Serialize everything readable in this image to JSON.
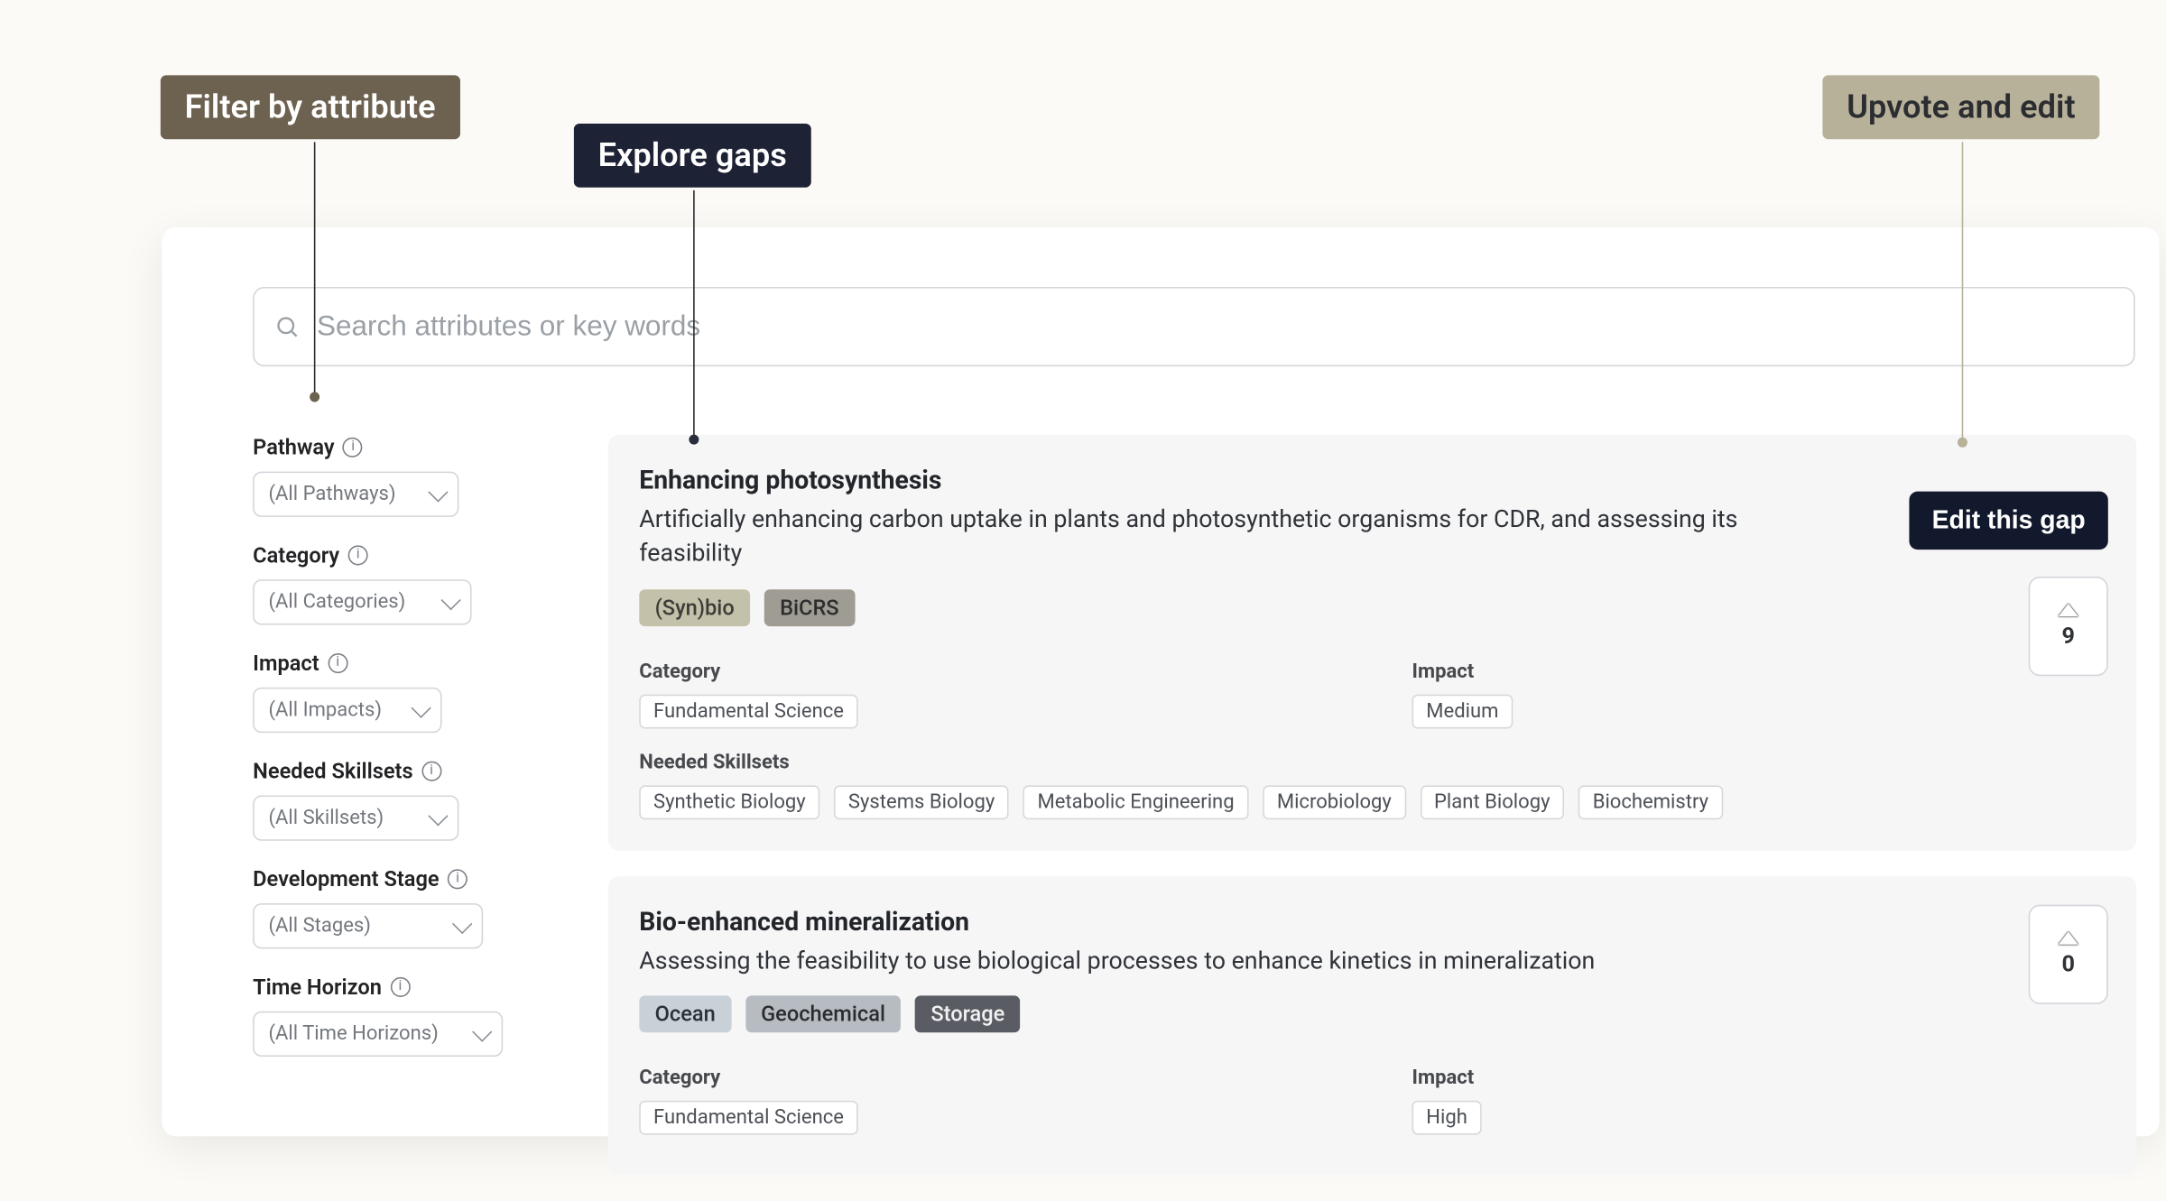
{
  "annotations": {
    "filter": "Filter by attribute",
    "explore": "Explore gaps",
    "upvote_edit": "Upvote and edit"
  },
  "search": {
    "placeholder": "Search attributes or key words"
  },
  "filters": {
    "pathway": {
      "label": "Pathway",
      "value": "(All Pathways)"
    },
    "category": {
      "label": "Category",
      "value": "(All Categories)"
    },
    "impact": {
      "label": "Impact",
      "value": "(All Impacts)"
    },
    "skillsets": {
      "label": "Needed Skillsets",
      "value": "(All Skillsets)"
    },
    "stage": {
      "label": "Development Stage",
      "value": "(All Stages)"
    },
    "horizon": {
      "label": "Time Horizon",
      "value": "(All Time Horizons)"
    }
  },
  "sections": {
    "category": "Category",
    "impact": "Impact",
    "skillsets": "Needed Skillsets",
    "edit_button": "Edit this gap"
  },
  "cards": [
    {
      "title": "Enhancing photosynthesis",
      "desc": "Artificially enhancing carbon uptake in plants and photosynthetic organisms for CDR, and assessing its feasibility",
      "pills": [
        {
          "text": "(Syn)bio",
          "cls": "soft-olive"
        },
        {
          "text": "BiCRS",
          "cls": "soft-grey"
        }
      ],
      "category": [
        "Fundamental Science"
      ],
      "impact": [
        "Medium"
      ],
      "skillsets": [
        "Synthetic Biology",
        "Systems Biology",
        "Metabolic Engineering",
        "Microbiology",
        "Plant Biology",
        "Biochemistry"
      ],
      "upvotes": 9
    },
    {
      "title": "Bio-enhanced mineralization",
      "desc": "Assessing the feasibility to use biological processes to enhance kinetics in mineralization",
      "pills": [
        {
          "text": "Ocean",
          "cls": "blue-grey"
        },
        {
          "text": "Geochemical",
          "cls": "grey-mid"
        },
        {
          "text": "Storage",
          "cls": "dark-grey"
        }
      ],
      "category": [
        "Fundamental Science"
      ],
      "impact": [
        "High"
      ],
      "skillsets": [],
      "upvotes": 0
    }
  ]
}
